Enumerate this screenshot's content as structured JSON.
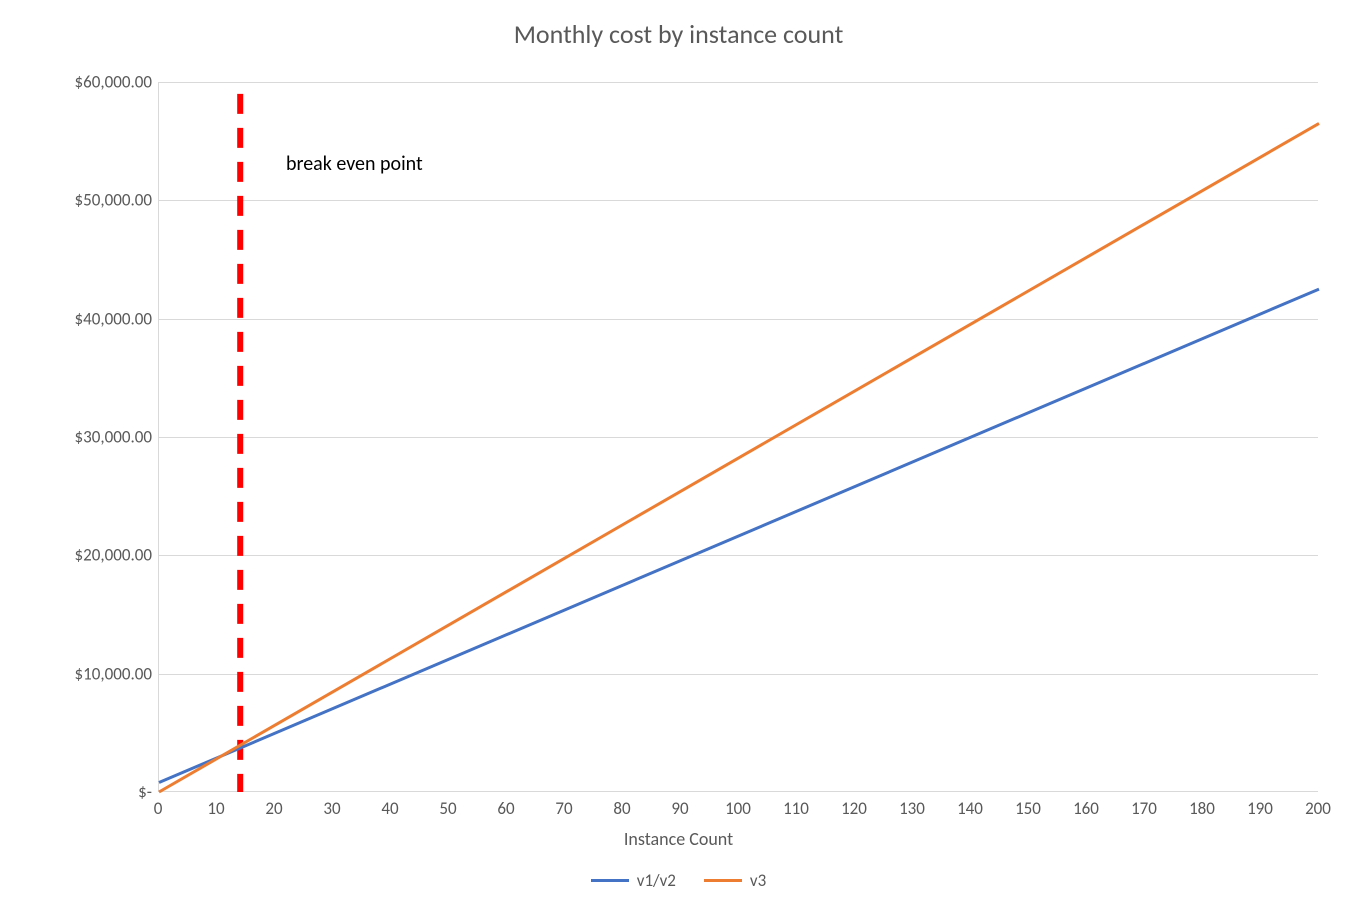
{
  "chart_data": {
    "type": "line",
    "title": "Monthly cost by instance count",
    "xlabel": "Instance Count",
    "ylabel": "",
    "xlim": [
      0,
      200
    ],
    "ylim": [
      0,
      60000
    ],
    "x_ticks": [
      0,
      10,
      20,
      30,
      40,
      50,
      60,
      70,
      80,
      90,
      100,
      110,
      120,
      130,
      140,
      150,
      160,
      170,
      180,
      190,
      200
    ],
    "y_ticks": [
      0,
      10000,
      20000,
      30000,
      40000,
      50000,
      60000
    ],
    "y_tick_labels": [
      "$-",
      "$10,000.00",
      "$20,000.00",
      "$30,000.00",
      "$40,000.00",
      "$50,000.00",
      "$60,000.00"
    ],
    "series": [
      {
        "name": "v1/v2",
        "color": "#4472C4",
        "x": [
          0,
          200
        ],
        "y": [
          800,
          42500
        ]
      },
      {
        "name": "v3",
        "color": "#ED7D31",
        "x": [
          0,
          200
        ],
        "y": [
          0,
          56500
        ]
      }
    ],
    "annotations": [
      {
        "kind": "vline",
        "x": 14,
        "y0": 0,
        "y1": 59000,
        "style": "dashed",
        "color": "#FF0000"
      },
      {
        "kind": "text",
        "text": "break even point",
        "x": 22,
        "y": 53000
      }
    ],
    "legend_position": "bottom",
    "grid": {
      "y": true,
      "x": false
    }
  }
}
